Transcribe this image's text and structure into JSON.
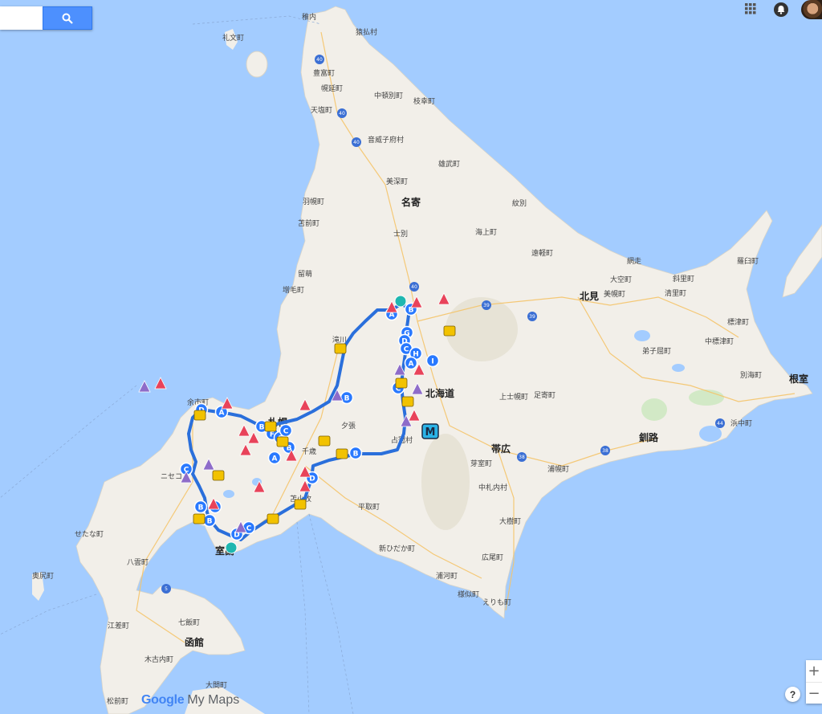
{
  "search": {
    "placeholder": "",
    "button_icon": "search-icon"
  },
  "topbar": {
    "apps_icon": "apps-grid-icon",
    "notifications_icon": "bell-icon",
    "avatar": "user-avatar"
  },
  "controls": {
    "zoom_in": "+",
    "zoom_out": "−",
    "help": "?"
  },
  "brand": {
    "google": "Google",
    "product": "My Maps"
  },
  "colors": {
    "water": "#a3ccff",
    "land": "#f2efe9",
    "route": "#2a6fdb",
    "marker_blue": "#2979ff",
    "marker_yellow": "#f2c200",
    "marker_red": "#e8435a",
    "marker_purple": "#8e6cc9",
    "marker_teal": "#1fb7b0"
  },
  "places": {
    "wakkanai": "稚内",
    "sarufutsu": "猿払村",
    "rebun": "礼文町",
    "toyotomi": "豊富町",
    "horonobe": "幌延町",
    "teshio": "天塩町",
    "nakatonbetsu": "中頓別町",
    "esashi_n": "枝幸町",
    "otoineppu": "音威子府村",
    "omu": "雄武町",
    "bifuka": "美深町",
    "nayoro": "名寄",
    "haboro": "羽幌町",
    "monbetsu": "紋別",
    "tomamae": "苫前町",
    "shibetsu": "士別",
    "kamikawa_ts": "海上町",
    "engaru": "遠軽町",
    "abashiri": "網走",
    "rumoi": "留萌",
    "mashike": "増毛町",
    "kitami": "北見",
    "ozora": "大空町",
    "bihoro": "美幌町",
    "shari": "斜里町",
    "kiyosato": "清里町",
    "rausu": "羅臼町",
    "shibetsu_e": "標津町",
    "nakashibetsu": "中標津町",
    "teshikaga": "弟子屈町",
    "betsukai": "別海町",
    "nemuro": "根室",
    "hamanaka": "浜中町",
    "kushiro": "釧路",
    "takikawa": "滝川",
    "yoichi": "余市町",
    "hokkaido": "北海道",
    "yubari": "夕張",
    "shimukappu": "占冠村",
    "kamishihoro": "上士幌町",
    "ashoro": "足寄町",
    "obihiro": "帯広",
    "memuro": "芽室町",
    "urahoro": "浦幌町",
    "niseko": "ニセコ",
    "tomakomai": "苫小牧",
    "chitose": "千歳",
    "sapporo": "札幌",
    "nakasatsunai": "中札内村",
    "hiratori": "平取町",
    "taiki": "大樹町",
    "setana": "せたな町",
    "okushiri": "奥尻町",
    "yakumo": "八雲町",
    "shinhidaka": "新ひだか町",
    "hiroo": "広尾町",
    "muroran": "室蘭",
    "urakawa": "浦河町",
    "samani": "様似町",
    "erimo": "えりも町",
    "esashi": "江差町",
    "nanae": "七飯町",
    "hakodate": "函館",
    "kikonai": "木古内町",
    "oma": "大間町",
    "matsumae": "松前町"
  },
  "route_shields": [
    "40",
    "40",
    "40",
    "40",
    "39",
    "39",
    "38",
    "38",
    "44",
    "5"
  ],
  "markers": {
    "letters": [
      "A",
      "B",
      "G",
      "D",
      "C",
      "H",
      "I",
      "A",
      "C",
      "B",
      "D",
      "A",
      "B",
      "F",
      "C",
      "A",
      "B",
      "D",
      "C",
      "B",
      "A",
      "B",
      "C",
      "D",
      "B",
      "C"
    ],
    "special": "M"
  }
}
